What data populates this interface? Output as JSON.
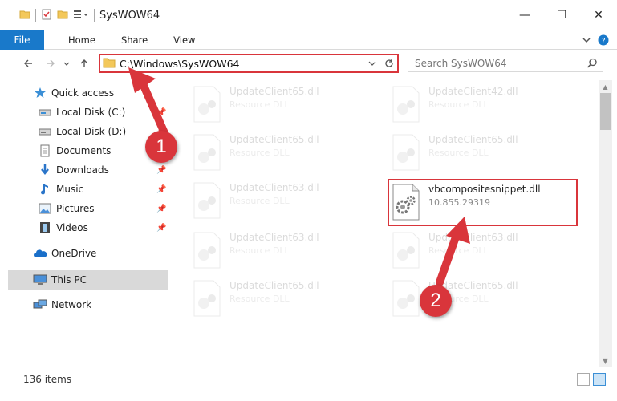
{
  "window": {
    "title": "SysWOW64",
    "minimize": "—",
    "maximize": "☐",
    "close": "✕"
  },
  "ribbon": {
    "file": "File",
    "tabs": [
      "Home",
      "Share",
      "View"
    ]
  },
  "address": {
    "path": "C:\\Windows\\SysWOW64",
    "search_placeholder": "Search SysWOW64"
  },
  "sidebar": {
    "items": [
      {
        "label": "Quick access",
        "icon": "star-icon"
      },
      {
        "label": "Local Disk (C:)",
        "icon": "drive-icon",
        "pinned": true
      },
      {
        "label": "Local Disk (D:)",
        "icon": "drive-icon",
        "pinned": true
      },
      {
        "label": "Documents",
        "icon": "documents-icon",
        "pinned": true
      },
      {
        "label": "Downloads",
        "icon": "download-icon",
        "pinned": true
      },
      {
        "label": "Music",
        "icon": "music-icon",
        "pinned": true
      },
      {
        "label": "Pictures",
        "icon": "pictures-icon",
        "pinned": true
      },
      {
        "label": "Videos",
        "icon": "videos-icon",
        "pinned": true
      },
      {
        "label": "OneDrive",
        "icon": "cloud-icon"
      },
      {
        "label": "This PC",
        "icon": "computer-icon",
        "selected": true
      },
      {
        "label": "Network",
        "icon": "network-icon"
      }
    ]
  },
  "files": [
    {
      "name": "UpdateClient65.dll",
      "sub": "Resource DLL",
      "faded": true
    },
    {
      "name": "UpdateClient42.dll",
      "sub": "Resource DLL",
      "faded": true
    },
    {
      "name": "UpdateClient65.dll",
      "sub": "Resource DLL",
      "faded": true
    },
    {
      "name": "UpdateClient65.dll",
      "sub": "Resource DLL",
      "faded": true
    },
    {
      "name": "UpdateClient63.dll",
      "sub": "Resource DLL",
      "faded": true
    },
    {
      "name": "vbcompositesnippet.dll",
      "sub": "10.855.29319",
      "faded": false
    },
    {
      "name": "UpdateClient63.dll",
      "sub": "Resource DLL",
      "faded": true
    },
    {
      "name": "UpdateClient63.dll",
      "sub": "Resource DLL",
      "faded": true
    },
    {
      "name": "UpdateClient65.dll",
      "sub": "Resource DLL",
      "faded": true
    },
    {
      "name": "UpdateClient65.dll",
      "sub": "Resource DLL",
      "faded": true
    }
  ],
  "status": {
    "count": "136 items"
  },
  "callouts": [
    "1",
    "2"
  ],
  "colors": {
    "accent": "#1979ca",
    "highlight": "#d9353b",
    "selection": "#d9d9d9"
  }
}
